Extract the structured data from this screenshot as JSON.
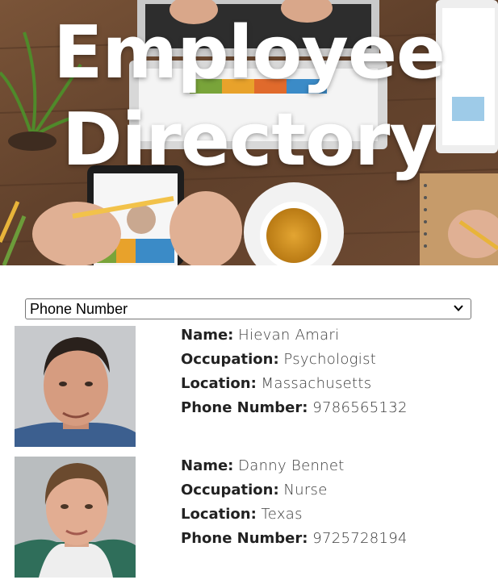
{
  "header": {
    "title_line1": "Employee",
    "title_line2": "Directory"
  },
  "sort": {
    "selected": "Phone Number",
    "icon": "chevron-down-icon"
  },
  "labels": {
    "name": "Name:",
    "occupation": "Occupation:",
    "location": "Location:",
    "phone": "Phone Number:"
  },
  "employees": [
    {
      "name": "Hievan Amari",
      "occupation": "Psychologist",
      "location": "Massachusetts",
      "phone": "9786565132"
    },
    {
      "name": "Danny Bennet",
      "occupation": "Nurse",
      "location": "Texas",
      "phone": "9725728194"
    }
  ],
  "colors": {
    "title_text": "#ffffff",
    "desk_wood": "#6b4a32",
    "body_text": "#333333"
  }
}
